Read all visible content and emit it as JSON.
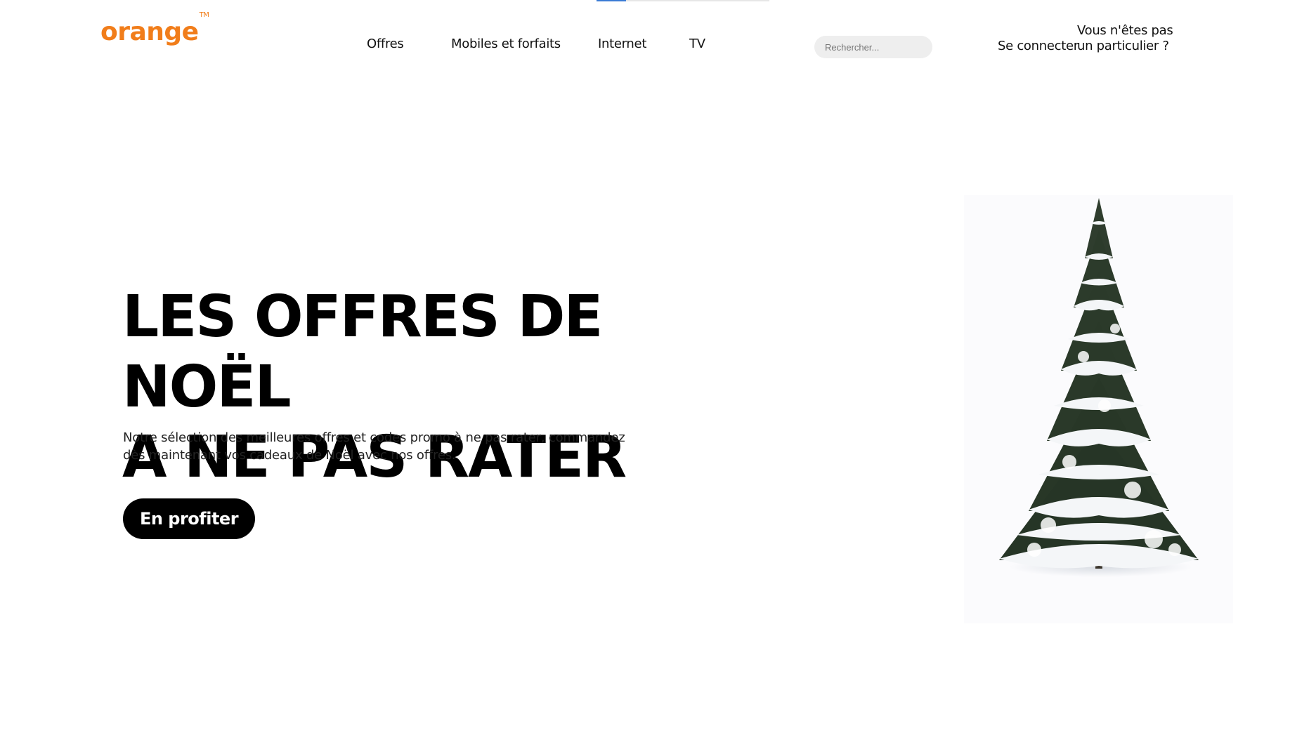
{
  "page_loading": {
    "progress": 0.17,
    "bar_color": "#3a7bd5",
    "track_color": "#e6e6e6"
  },
  "header": {
    "logo_text": "orange",
    "logo_mark": "TM",
    "brand_color": "#f17d1a",
    "nav": [
      {
        "label": "Offres"
      },
      {
        "label": "Mobiles et forfaits"
      },
      {
        "label": "Internet"
      },
      {
        "label": "TV"
      }
    ],
    "search": {
      "placeholder": "Rechercher...",
      "value": ""
    },
    "not_particulier_label": "Vous n'êtes pas un particulier ?",
    "login_label": "Se connecter"
  },
  "hero": {
    "title_line1": "LES OFFRES DE NOËL",
    "title_line2": "A NE PAS RATER",
    "text_line1": "Notre sélection des meilleures offres et codes promo à ne pas rater, commandez",
    "text_line2": "dès maintenant vos cadeaux de Noël avec nos offres.",
    "cta_label": "En profiter",
    "image_icon": "snowy-christmas-tree"
  }
}
